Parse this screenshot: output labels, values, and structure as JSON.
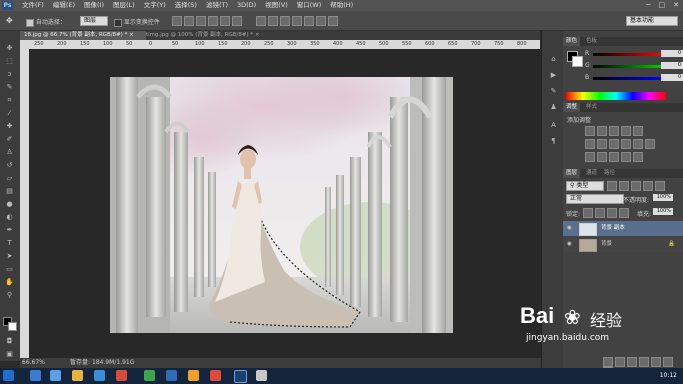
{
  "app": {
    "logo": "Ps"
  },
  "menu": [
    "文件(F)",
    "编辑(E)",
    "图像(I)",
    "图层(L)",
    "文字(Y)",
    "选择(S)",
    "滤镜(T)",
    "3D(D)",
    "视图(V)",
    "窗口(W)",
    "帮助(H)"
  ],
  "window_controls": [
    "─",
    "□",
    "✕"
  ],
  "options": {
    "auto_select_label": "自动选择：",
    "auto_select_value": "图层",
    "show_transform_label": "显示变换控件",
    "workspace": "基本功能"
  },
  "tabs": [
    {
      "label": "18.jpg @ 66.7% (背景 副本, RGB/8#) *",
      "close": "×"
    },
    {
      "label": "timg.jpg @ 100% (背景 副本, RGB/8#) *",
      "close": "×"
    }
  ],
  "ruler_ticks": [
    "250",
    "200",
    "150",
    "100",
    "50",
    "0",
    "50",
    "100",
    "150",
    "200",
    "250",
    "300",
    "350",
    "400",
    "450",
    "500",
    "550",
    "600",
    "650",
    "700",
    "750",
    "800"
  ],
  "status": {
    "zoom": "66.67%",
    "doc_label": "暂存盘:",
    "doc_value": "184.9M/1.91G"
  },
  "color_panel": {
    "tabs": [
      "颜色",
      "色板"
    ],
    "channels": [
      {
        "name": "R",
        "value": "0",
        "color": "#ff0000"
      },
      {
        "name": "G",
        "value": "0",
        "color": "#00c000"
      },
      {
        "name": "B",
        "value": "0",
        "color": "#0000ff"
      }
    ]
  },
  "adjust_panel": {
    "tabs": [
      "调整",
      "样式"
    ],
    "title": "添加调整"
  },
  "layers_panel": {
    "tabs": [
      "图层",
      "通道",
      "路径"
    ],
    "kind_label": "类型",
    "blend_mode": "正常",
    "opacity_label": "不透明度:",
    "opacity_value": "100%",
    "lock_label": "锁定:",
    "fill_label": "填充:",
    "fill_value": "100%",
    "layers": [
      {
        "name": "背景 副本",
        "selected": true
      },
      {
        "name": "背景",
        "selected": false
      }
    ]
  },
  "watermark": {
    "brand": "Bai",
    "brand2": "经验",
    "url": "jingyan.baidu.com"
  },
  "taskbar": {
    "time": "10:12"
  }
}
